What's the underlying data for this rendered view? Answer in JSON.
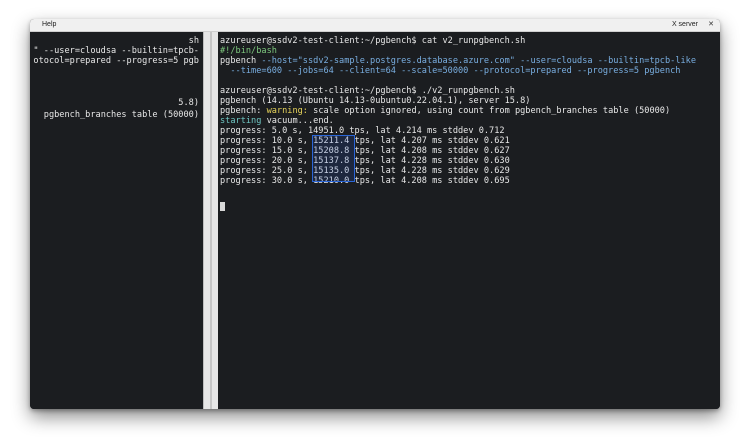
{
  "menubar": {
    "help": "Help",
    "xserver": "X server",
    "close": "✕"
  },
  "left_pane": {
    "lines": [
      "sh",
      "\" --user=cloudsa --builtin=tpcb-",
      "otocol=prepared --progress=5 pgb",
      "5.8)",
      "pgbench_branches table (50000)"
    ]
  },
  "right_pane": {
    "prompt1": "azureuser@ssdv2-test-client:~/pgbench$ cat v2_runpgbench.sh",
    "shebang": "#!/bin/bash",
    "cmd1": "pgbench ",
    "cmd2": "--host=\"ssdv2-sample.postgres.database.azure.com\" ",
    "cmd3": "--user=cloudsa ",
    "cmd4": "--builtin=tpcb-like",
    "cmd5": "  --time=600 --jobs=64 --client=64 --scale=50000 --protocol=prepared --progress=5 pgbench",
    "prompt2": "azureuser@ssdv2-test-client:~/pgbench$ ./v2_runpgbench.sh",
    "version": "pgbench (14.13 (Ubuntu 14.13-0ubuntu0.22.04.1), server 15.8)",
    "warn_prefix": "pgbench: ",
    "warn_word": "warning:",
    "warn_rest": " scale option ignored, using count from pgbench_branches table (50000)",
    "vacuum_word": "starting",
    "vacuum_rest": " vacuum...end.",
    "progress": [
      "progress: 5.0 s, 14951.0 tps, lat 4.214 ms stddev 0.712",
      "progress: 10.0 s, 15211.4 tps, lat 4.207 ms stddev 0.621",
      "progress: 15.0 s, 15208.8 tps, lat 4.208 ms stddev 0.627",
      "progress: 20.0 s, 15137.8 tps, lat 4.228 ms stddev 0.630",
      "progress: 25.0 s, 15135.0 tps, lat 4.228 ms stddev 0.629",
      "progress: 30.0 s, 15210.0 tps, lat 4.208 ms stddev 0.695"
    ]
  }
}
